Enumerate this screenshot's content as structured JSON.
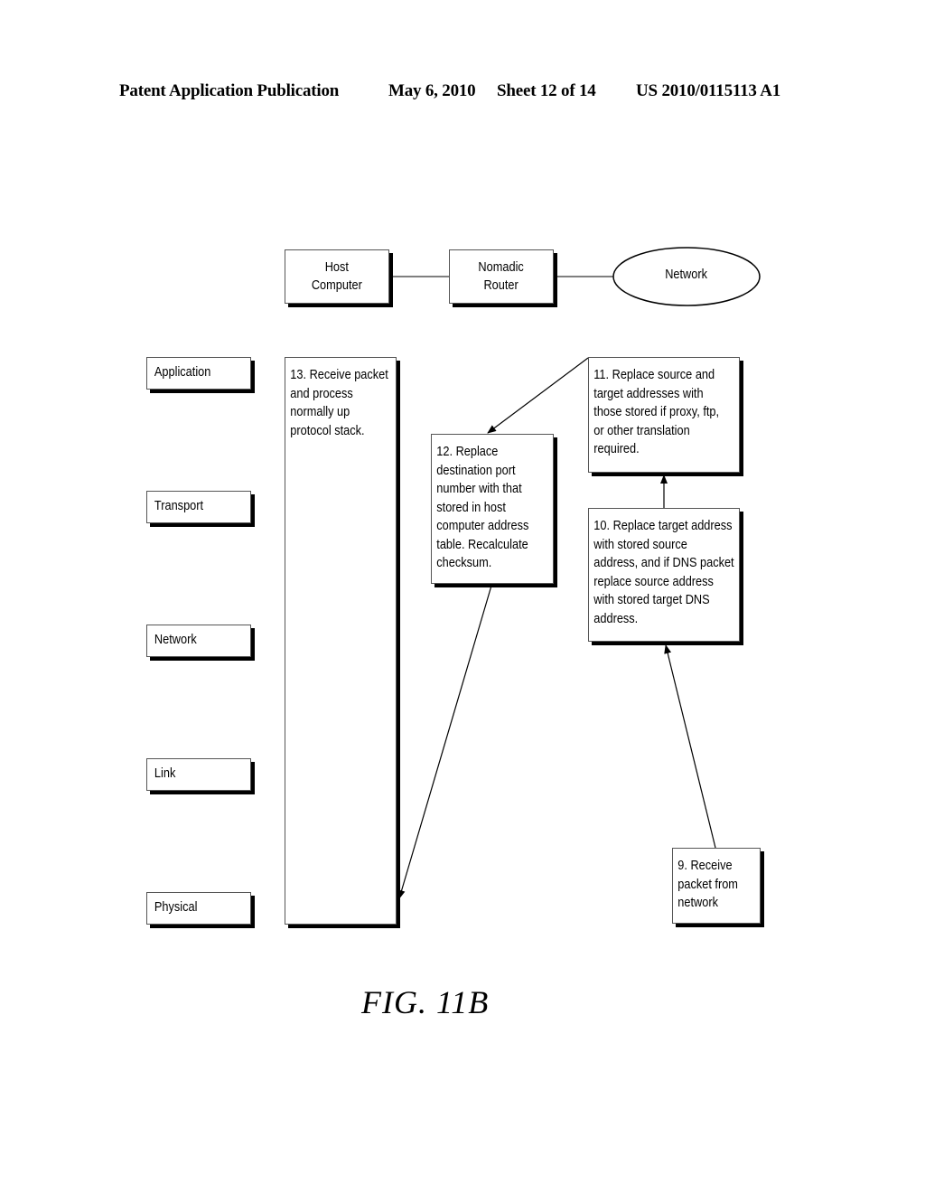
{
  "header": {
    "publication": "Patent Application Publication",
    "date": "May 6, 2010",
    "sheet": "Sheet 12 of 14",
    "number": "US 2010/0115113 A1"
  },
  "topology": {
    "host": [
      "Host",
      "Computer"
    ],
    "router": [
      "Nomadic",
      "Router"
    ],
    "network": "Network"
  },
  "layers": [
    "Application",
    "Transport",
    "Network",
    "Link",
    "Physical"
  ],
  "steps": {
    "s9": [
      "9. Receive",
      "packet from",
      "network"
    ],
    "s10": [
      "10. Replace target address",
      "with stored source",
      "address, and if DNS packet",
      "replace source address",
      "with stored target DNS",
      "address."
    ],
    "s11": [
      "11. Replace source and",
      "target addresses with",
      "those stored if proxy, ftp,",
      "or other translation",
      "required."
    ],
    "s12": [
      "12. Replace",
      "destination port",
      "number with that",
      "stored in host",
      "computer address",
      "table. Recalculate",
      "checksum."
    ],
    "s13": [
      "13. Receive packet",
      "and process",
      "normally up",
      "protocol stack."
    ]
  },
  "figure_label": "FIG. 11B"
}
